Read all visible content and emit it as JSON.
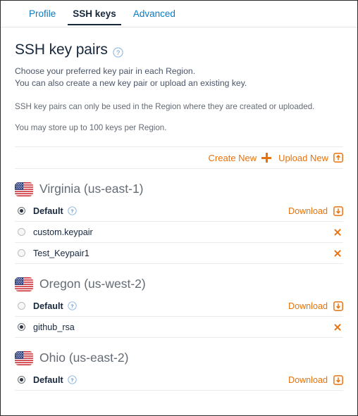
{
  "tabs": [
    {
      "label": "Profile",
      "active": false
    },
    {
      "label": "SSH keys",
      "active": true
    },
    {
      "label": "Advanced",
      "active": false
    }
  ],
  "page": {
    "title": "SSH key pairs",
    "title_help_icon": "help-circle-icon",
    "intro_line_1": "Choose your preferred key pair in each Region.",
    "intro_line_2": "You can also create a new key pair or upload an existing key.",
    "note_1": "SSH key pairs can only be used in the Region where they are created or uploaded.",
    "note_2": "You may store up to 100 keys per Region."
  },
  "actions": {
    "create_new_label": "Create New",
    "create_new_icon": "plus-icon",
    "upload_new_label": "Upload New",
    "upload_new_icon": "upload-box-icon"
  },
  "labels": {
    "download": "Download",
    "download_icon": "download-box-icon",
    "delete_icon": "close-x-icon",
    "flag_icon": "us-flag-icon",
    "help_icon": "help-circle-icon"
  },
  "colors": {
    "accent_orange": "#e8720c",
    "link_blue": "#0a7bc4",
    "title_navy": "#17273c",
    "muted_gray": "#646b74",
    "divider": "#ebebeb"
  },
  "regions": [
    {
      "name": "Virginia (us-east-1)",
      "keys": [
        {
          "label": "Default",
          "selected": true,
          "bold": true,
          "has_help": true,
          "action": "download"
        },
        {
          "label": "custom.keypair",
          "selected": false,
          "bold": false,
          "has_help": false,
          "action": "delete"
        },
        {
          "label": "Test_Keypair1",
          "selected": false,
          "bold": false,
          "has_help": false,
          "action": "delete"
        }
      ]
    },
    {
      "name": "Oregon (us-west-2)",
      "keys": [
        {
          "label": "Default",
          "selected": false,
          "bold": true,
          "has_help": true,
          "action": "download"
        },
        {
          "label": "github_rsa",
          "selected": true,
          "bold": false,
          "has_help": false,
          "action": "delete"
        }
      ]
    },
    {
      "name": "Ohio (us-east-2)",
      "keys": [
        {
          "label": "Default",
          "selected": true,
          "bold": true,
          "has_help": true,
          "action": "download"
        }
      ]
    }
  ]
}
